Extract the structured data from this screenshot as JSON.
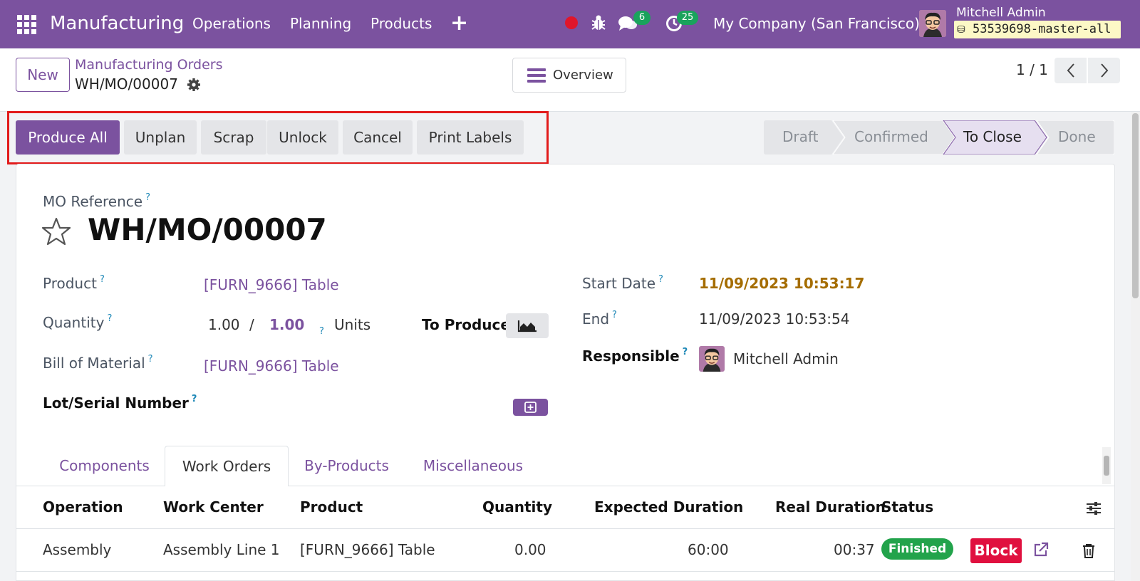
{
  "navbar": {
    "app_name": "Manufacturing",
    "menus": [
      "Operations",
      "Planning",
      "Products"
    ],
    "add_icon": "+",
    "messages_count": "6",
    "activities_count": "25",
    "company": "My Company (San Francisco)",
    "user_name": "Mitchell Admin",
    "db_name": "53539698-master-all",
    "brand_color": "#7b529f"
  },
  "control_panel": {
    "new_label": "New",
    "breadcrumb_parent": "Manufacturing Orders",
    "breadcrumb_current": "WH/MO/00007",
    "overview_label": "Overview",
    "pager": "1 / 1"
  },
  "statusbar": {
    "buttons": [
      "Produce All",
      "Unplan",
      "Scrap",
      "Unlock",
      "Cancel",
      "Print Labels"
    ],
    "stages": [
      "Draft",
      "Confirmed",
      "To Close",
      "Done"
    ],
    "active_stage": "To Close"
  },
  "form": {
    "mo_reference_label": "MO Reference",
    "mo_reference": "WH/MO/00007",
    "product_label": "Product",
    "product_value": "[FURN_9666] Table",
    "quantity_label": "Quantity",
    "qty_produced": "1.00",
    "qty_separator": "/",
    "qty_total": "1.00",
    "uom": "Units",
    "to_produce_label": "To Produce",
    "bom_label": "Bill of Material",
    "bom_value": "[FURN_9666] Table",
    "lot_label": "Lot/Serial Number",
    "start_date_label": "Start Date",
    "start_date": "11/09/2023 10:53:17",
    "end_label": "End",
    "end_date": "11/09/2023 10:53:54",
    "responsible_label": "Responsible",
    "responsible": "Mitchell Admin",
    "help_mark": "?"
  },
  "tabs": {
    "items": [
      "Components",
      "Work Orders",
      "By-Products",
      "Miscellaneous"
    ],
    "active": "Work Orders"
  },
  "work_orders": {
    "columns": [
      "Operation",
      "Work Center",
      "Product",
      "Quantity",
      "Expected Duration",
      "Real Duration",
      "Status"
    ],
    "rows": [
      {
        "operation": "Assembly",
        "work_center": "Assembly Line 1",
        "product": "[FURN_9666] Table",
        "quantity": "0.00",
        "expected_duration": "60:00",
        "real_duration": "00:37",
        "status": "Finished",
        "block_label": "Block"
      }
    ]
  },
  "colors": {
    "start_date": "#a56d00",
    "finished_badge": "#22a34b",
    "block_button": "#e0103f",
    "highlight_box": "#e21b1b"
  }
}
